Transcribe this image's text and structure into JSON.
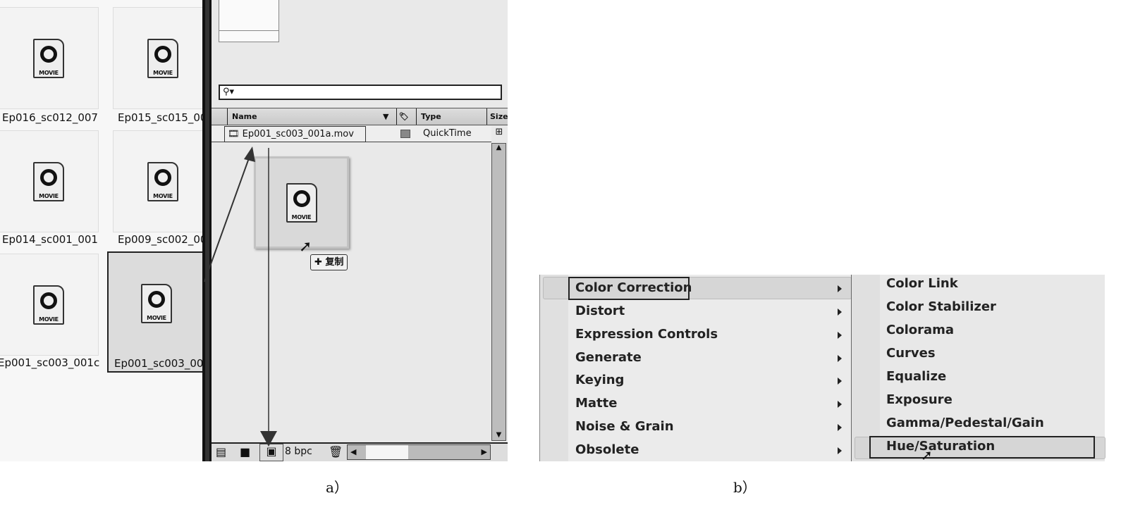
{
  "explorer": {
    "files": [
      {
        "name": "Ep016_sc012_007",
        "selected": false
      },
      {
        "name": "Ep015_sc015_00",
        "selected": false
      },
      {
        "name": "Ep014_sc001_001",
        "selected": false
      },
      {
        "name": "Ep009_sc002_00",
        "selected": false
      },
      {
        "name": "Ep001_sc003_001c",
        "selected": false
      },
      {
        "name": "Ep001_sc003_00",
        "selected": true
      }
    ],
    "icon_label": "MOVIE"
  },
  "project": {
    "search_placeholder": "",
    "columns": {
      "name": "Name",
      "type": "Type",
      "size": "Size"
    },
    "row": {
      "name": "Ep001_sc003_001a.mov",
      "type": "QuickTime"
    },
    "drag_tooltip": "复制",
    "bpc": "8 bpc"
  },
  "menu": {
    "items": [
      "Color Correction",
      "Distort",
      "Expression Controls",
      "Generate",
      "Keying",
      "Matte",
      "Noise & Grain",
      "Obsolete"
    ],
    "highlighted": "Color Correction"
  },
  "submenu": {
    "items": [
      "Color Link",
      "Color Stabilizer",
      "Colorama",
      "Curves",
      "Equalize",
      "Exposure",
      "Gamma/Pedestal/Gain",
      "Hue/Saturation"
    ],
    "highlighted": "Hue/Saturation"
  },
  "captions": {
    "a": "a）",
    "b": "b）"
  }
}
